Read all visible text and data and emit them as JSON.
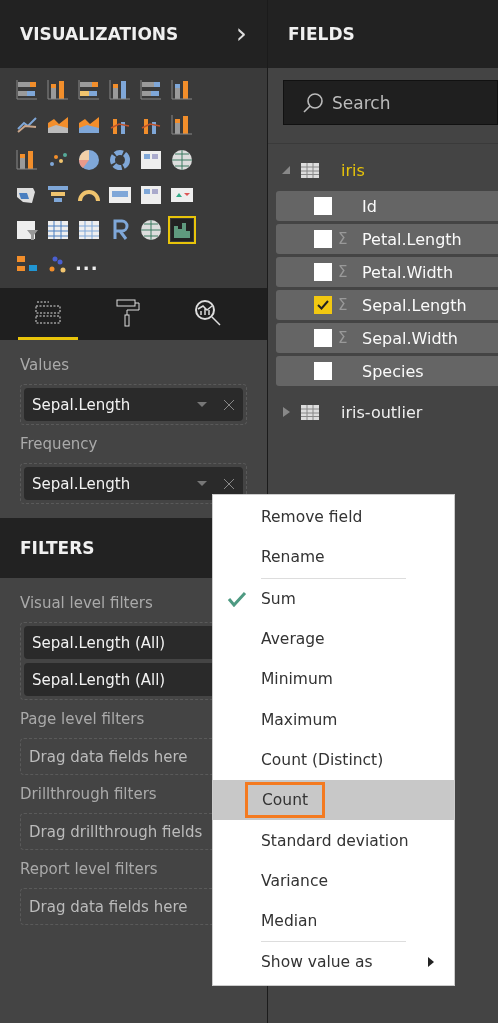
{
  "visualizations": {
    "title": "VISUALIZATIONS",
    "chevron": "›",
    "items": [
      {
        "selected": false
      },
      {
        "selected": false
      },
      {
        "selected": false
      },
      {
        "selected": false
      },
      {
        "selected": false
      },
      {
        "selected": false
      },
      {
        "selected": false
      },
      {
        "selected": false
      },
      {
        "selected": false
      },
      {
        "selected": false
      },
      {
        "selected": false
      },
      {
        "selected": false
      },
      {
        "selected": false
      },
      {
        "selected": false
      },
      {
        "selected": false
      },
      {
        "selected": false
      },
      {
        "selected": false
      },
      {
        "selected": false
      },
      {
        "selected": false
      },
      {
        "selected": false
      },
      {
        "selected": false
      },
      {
        "selected": false
      },
      {
        "selected": false
      },
      {
        "selected": false
      },
      {
        "selected": false
      },
      {
        "selected": false
      },
      {
        "selected": false
      },
      {
        "selected": false
      },
      {
        "selected": false
      },
      {
        "selected": true
      },
      {
        "selected": false
      },
      {
        "selected": false
      }
    ],
    "more": "···",
    "tabs": [
      {
        "kind": "fields",
        "selected": true
      },
      {
        "kind": "format",
        "selected": false
      },
      {
        "kind": "analytics",
        "selected": false
      }
    ],
    "wells": [
      {
        "label": "Values",
        "fields": [
          "Sepal.Length"
        ]
      },
      {
        "label": "Frequency",
        "fields": [
          "Sepal.Length"
        ]
      }
    ]
  },
  "filters": {
    "title": "FILTERS",
    "sections": [
      {
        "label": "Visual level filters",
        "fields": [
          "Sepal.Length (All)",
          "Sepal.Length (All)"
        ]
      },
      {
        "label": "Page level filters",
        "placeholder": "Drag data fields here"
      },
      {
        "label": "Drillthrough filters",
        "placeholder": "Drag drillthrough fields"
      },
      {
        "label": "Report level filters",
        "placeholder": "Drag data fields here"
      }
    ]
  },
  "fields": {
    "title": "FIELDS",
    "search": {
      "placeholder": "Search"
    },
    "tables": [
      {
        "name": "iris",
        "expanded": true,
        "columns": [
          {
            "name": "Id",
            "checked": false
          },
          {
            "name": "Petal.Length",
            "sigma": "Σ",
            "checked": false
          },
          {
            "name": "Petal.Width",
            "sigma": "Σ",
            "checked": false
          },
          {
            "name": "Sepal.Length",
            "sigma": "Σ",
            "checked": true
          },
          {
            "name": "Sepal.Width",
            "sigma": "Σ",
            "checked": false
          },
          {
            "name": "Species",
            "checked": false
          }
        ]
      },
      {
        "name": "iris-outlier",
        "expanded": false
      }
    ]
  },
  "context_menu": {
    "items": [
      {
        "kind": "item",
        "label": "Remove field",
        "checked": false,
        "selected": false
      },
      {
        "kind": "item",
        "label": "Rename",
        "checked": false,
        "selected": false
      },
      {
        "kind": "separator"
      },
      {
        "kind": "item",
        "label": "Sum",
        "checked": true,
        "selected": false
      },
      {
        "kind": "item",
        "label": "Average",
        "checked": false,
        "selected": false
      },
      {
        "kind": "item",
        "label": "Minimum",
        "checked": false,
        "selected": false
      },
      {
        "kind": "item",
        "label": "Maximum",
        "checked": false,
        "selected": false
      },
      {
        "kind": "item",
        "label": "Count (Distinct)",
        "checked": false,
        "selected": false
      },
      {
        "kind": "item",
        "label": "Count",
        "checked": false,
        "selected": true
      },
      {
        "kind": "item",
        "label": "Standard deviation",
        "checked": false,
        "selected": false
      },
      {
        "kind": "item",
        "label": "Variance",
        "checked": false,
        "selected": false
      },
      {
        "kind": "item",
        "label": "Median",
        "checked": false,
        "selected": false
      },
      {
        "kind": "separator"
      },
      {
        "kind": "submenu",
        "label": "Show value as",
        "checked": false,
        "selected": false
      }
    ]
  }
}
